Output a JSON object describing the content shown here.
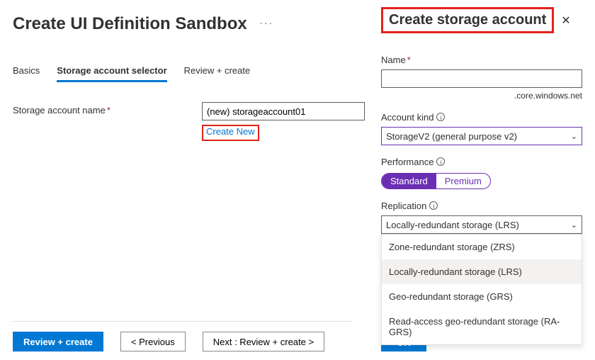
{
  "page": {
    "title": "Create UI Definition Sandbox"
  },
  "tabs": {
    "basics": "Basics",
    "selector": "Storage account selector",
    "review": "Review + create"
  },
  "form": {
    "label": "Storage account name",
    "value": "(new) storageaccount01",
    "create_new": "Create New"
  },
  "footer": {
    "review": "Review + create",
    "prev": "< Previous",
    "next": "Next : Review + create >"
  },
  "panel": {
    "title": "Create storage account",
    "name_label": "Name",
    "name_suffix": ".core.windows.net",
    "kind_label": "Account kind",
    "kind_value": "StorageV2 (general purpose v2)",
    "perf_label": "Performance",
    "perf_standard": "Standard",
    "perf_premium": "Premium",
    "repl_label": "Replication",
    "repl_value": "Locally-redundant storage (LRS)",
    "repl_options": {
      "zrs": "Zone-redundant storage (ZRS)",
      "lrs": "Locally-redundant storage (LRS)",
      "grs": "Geo-redundant storage (GRS)",
      "ragrs": "Read-access geo-redundant storage (RA-GRS)"
    },
    "ok": "OK"
  }
}
